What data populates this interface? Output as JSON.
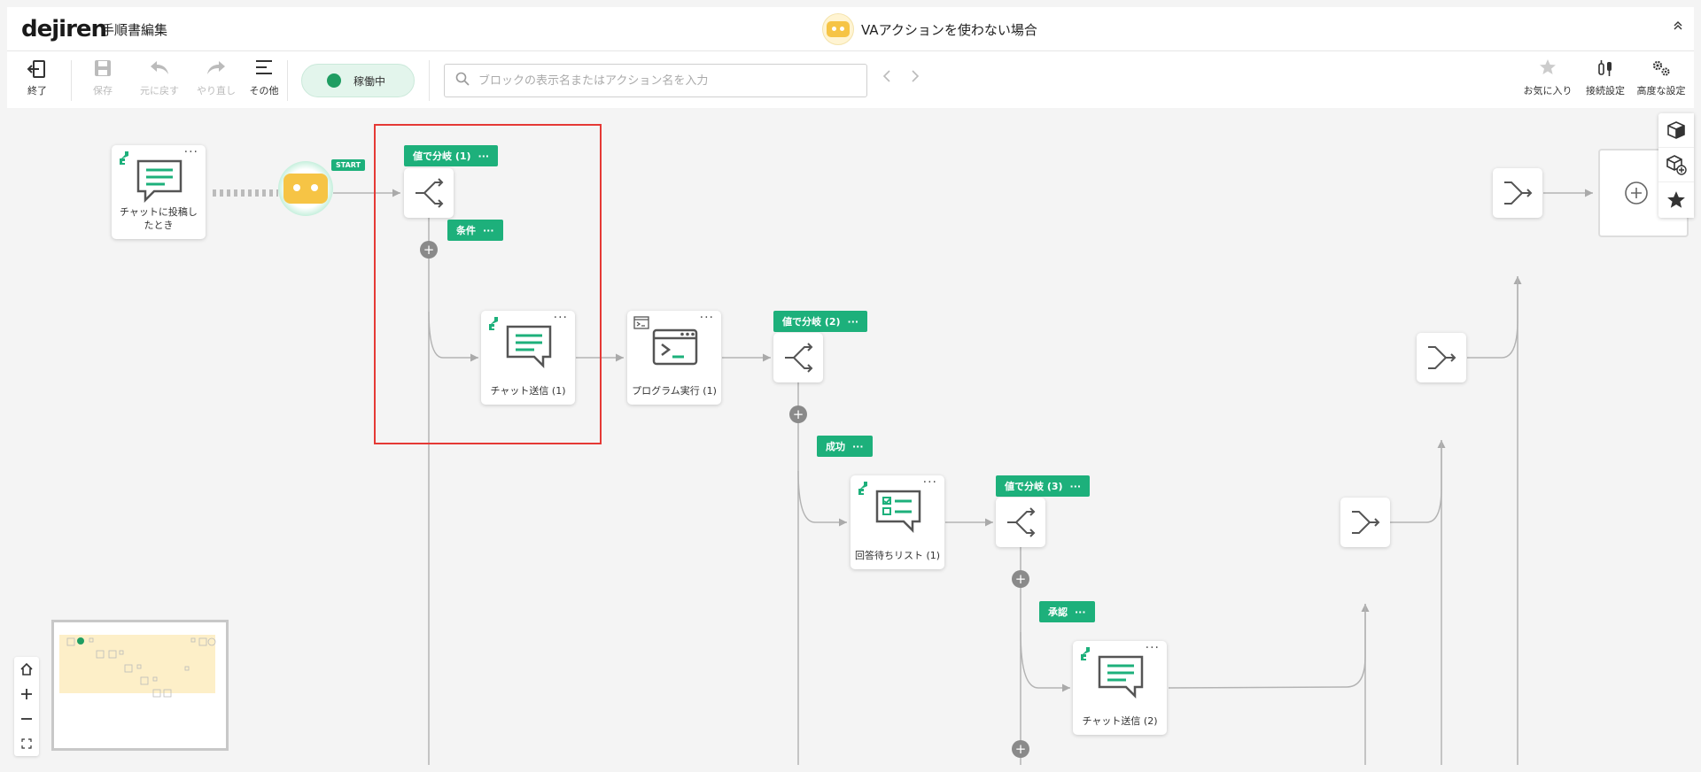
{
  "header": {
    "logo": "dejiren",
    "page_title": "手順書編集",
    "flow_title": "VAアクションを使わない場合"
  },
  "toolbar": {
    "exit_label": "終了",
    "save_label": "保存",
    "undo_label": "元に戻す",
    "redo_label": "やり直し",
    "other_label": "その他",
    "status_label": "稼働中",
    "search_placeholder": "ブロックの表示名またはアクション名を入力",
    "favorite_label": "お気に入り",
    "connection_label": "接続設定",
    "advanced_label": "高度な設定"
  },
  "canvas": {
    "start_badge": "START",
    "nodes": {
      "trigger": "チャットに投稿したとき",
      "chat1": "チャット送信 (1)",
      "program1": "プログラム実行 (1)",
      "answer_list1": "回答待ちリスト (1)",
      "chat2": "チャット送信 (2)"
    },
    "tags": {
      "branch1": "値で分岐 (1)",
      "cond": "条件",
      "branch2": "値で分岐 (2)",
      "success": "成功",
      "branch3": "値で分岐 (3)",
      "approve": "承認"
    },
    "more": "···"
  },
  "colors": {
    "accent": "#1db07b",
    "status": "#1f9d62",
    "bot": "#f6c445",
    "highlight": "#e53935"
  }
}
